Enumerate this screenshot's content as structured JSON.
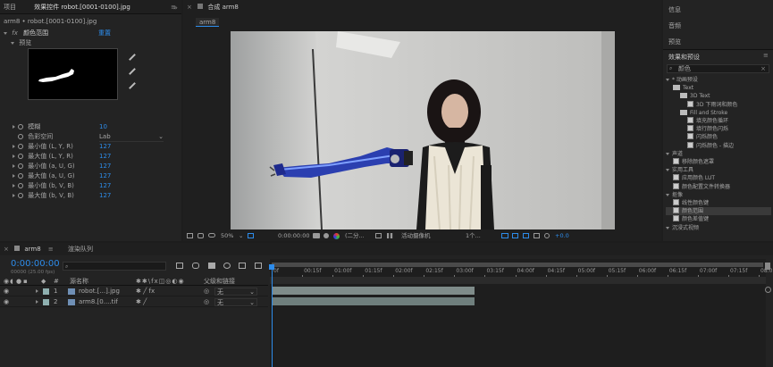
{
  "project_panel": {
    "tab": "项目",
    "filename": "arm8 • robot.[0001-0100].jpg"
  },
  "effect_controls": {
    "tab": "效果控件 robot.[0001-0100].jpg",
    "effect_name": "颜色范围",
    "reset": "重置",
    "preview_label": "预览",
    "props": [
      {
        "label": "模糊",
        "value": "10"
      },
      {
        "label": "色彩空间",
        "value": "Lab"
      },
      {
        "label": "最小值 (L, Y, R)",
        "value": "127"
      },
      {
        "label": "最大值 (L, Y, R)",
        "value": "127"
      },
      {
        "label": "最小值 (a, U, G)",
        "value": "127"
      },
      {
        "label": "最大值 (a, U, G)",
        "value": "127"
      },
      {
        "label": "最小值 (b, V, B)",
        "value": "127"
      },
      {
        "label": "最大值 (b, V, B)",
        "value": "127"
      }
    ]
  },
  "composition": {
    "tab": "合成 arm8",
    "sub_tab": "arm8",
    "footer": {
      "zoom": "50%",
      "timecode": "0:00:00:00",
      "quality": "(二分...",
      "camera": "活动摄像机",
      "views": "1个...",
      "exposure": "+0.0"
    }
  },
  "right_panel": {
    "sections": [
      "信息",
      "音频",
      "预览"
    ],
    "effects_title": "效果和预设",
    "search_value": "颜色",
    "tree": [
      {
        "label": "* 动画预设",
        "indent": 0,
        "kind": "cat"
      },
      {
        "label": "Text",
        "indent": 1,
        "kind": "folder"
      },
      {
        "label": "3D Text",
        "indent": 2,
        "kind": "folder"
      },
      {
        "label": "3D 下雨词和颜色",
        "indent": 3,
        "kind": "fx"
      },
      {
        "label": "Fill and Stroke",
        "indent": 2,
        "kind": "folder"
      },
      {
        "label": "填充颜色循环",
        "indent": 3,
        "kind": "fx"
      },
      {
        "label": "填行颜色闪烁",
        "indent": 3,
        "kind": "fx"
      },
      {
        "label": "闪烁颜色",
        "indent": 3,
        "kind": "fx"
      },
      {
        "label": "闪烁颜色 - 描边",
        "indent": 3,
        "kind": "fx"
      },
      {
        "label": "声道",
        "indent": 0,
        "kind": "cat"
      },
      {
        "label": "移除颜色遮罩",
        "indent": 1,
        "kind": "fx"
      },
      {
        "label": "实用工具",
        "indent": 0,
        "kind": "cat"
      },
      {
        "label": "应用颜色 LUT",
        "indent": 1,
        "kind": "fx"
      },
      {
        "label": "颜色配置文件转换器",
        "indent": 1,
        "kind": "fx"
      },
      {
        "label": "抠像",
        "indent": 0,
        "kind": "cat"
      },
      {
        "label": "线性颜色键",
        "indent": 1,
        "kind": "fx"
      },
      {
        "label": "颜色范围",
        "indent": 1,
        "kind": "fx",
        "selected": true
      },
      {
        "label": "颜色差值键",
        "indent": 1,
        "kind": "fx"
      },
      {
        "label": "沉浸式视频",
        "indent": 0,
        "kind": "cat"
      }
    ]
  },
  "timeline": {
    "comp_tab": "arm8",
    "render_tab": "渲染队列",
    "timecode": "0:00:00:00",
    "frame_info": "00000 (25.00 fps)",
    "col_name": "源名称",
    "col_parent": "父级和链接",
    "ruler": [
      "0f",
      "00:15f",
      "01:00f",
      "01:15f",
      "02:00f",
      "02:15f",
      "03:00f",
      "03:15f",
      "04:00f",
      "04:15f",
      "05:00f",
      "05:15f",
      "06:00f",
      "06:15f",
      "07:00f",
      "07:15f",
      "08:0"
    ],
    "layers": [
      {
        "num": "1",
        "name": "robot.[...].jpg",
        "parent": "无"
      },
      {
        "num": "2",
        "name": "arm8.[0....tif",
        "parent": "无"
      }
    ]
  },
  "colors": {
    "accent": "#2d8ceb",
    "layer1_track": "#7f8c8a",
    "layer2_track": "#6f7f7d"
  }
}
